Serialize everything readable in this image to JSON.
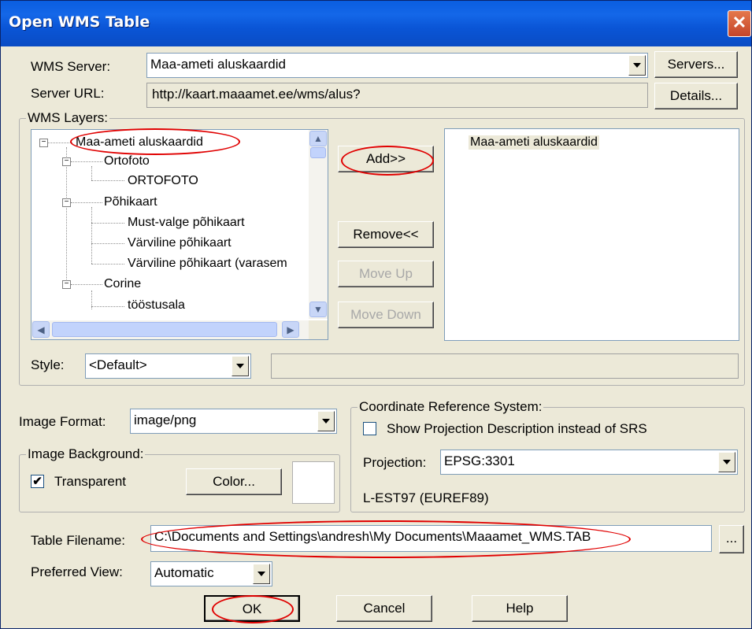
{
  "window": {
    "title": "Open WMS Table",
    "close_glyph": "✕"
  },
  "server": {
    "label": "WMS Server:",
    "value": "Maa-ameti aluskaardid",
    "servers_btn": "Servers...",
    "url_label": "Server URL:",
    "url_value": "http://kaart.maaamet.ee/wms/alus?",
    "details_btn": "Details..."
  },
  "layers": {
    "group_label": "WMS Layers:",
    "tree": [
      "Maa-ameti aluskaardid",
      "Ortofoto",
      "ORTOFOTO",
      "Põhikaart",
      "Must-valge põhikaart",
      "Värviline põhikaart",
      "Värviline põhikaart (varasem",
      "Corine",
      "tööstusala"
    ],
    "add_btn": "Add>>",
    "remove_btn": "Remove<<",
    "move_up_btn": "Move Up",
    "move_down_btn": "Move Down",
    "selected": [
      "Maa-ameti aluskaardid"
    ],
    "style_label": "Style:",
    "style_value": "<Default>",
    "style_desc": ""
  },
  "image": {
    "format_label": "Image Format:",
    "format_value": "image/png",
    "background_group": "Image Background:",
    "transparent_label": "Transparent",
    "transparent_checked": true,
    "check_glyph": "✔",
    "color_btn": "Color..."
  },
  "crs": {
    "group_label": "Coordinate Reference System:",
    "show_desc_label": "Show Projection Description instead of SRS",
    "show_desc_checked": false,
    "projection_label": "Projection:",
    "projection_value": "EPSG:3301",
    "projection_name": "L-EST97 (EUREF89)"
  },
  "output": {
    "filename_label": "Table Filename:",
    "filename_value": "C:\\Documents and Settings\\andresh\\My Documents\\Maaamet_WMS.TAB",
    "browse_btn": "...",
    "view_label": "Preferred View:",
    "view_value": "Automatic"
  },
  "footer": {
    "ok": "OK",
    "cancel": "Cancel",
    "help": "Help"
  },
  "colors": {
    "annotation": "#e00000",
    "titlebar": "#0a5ee0",
    "dialog_bg": "#ece9d8"
  }
}
